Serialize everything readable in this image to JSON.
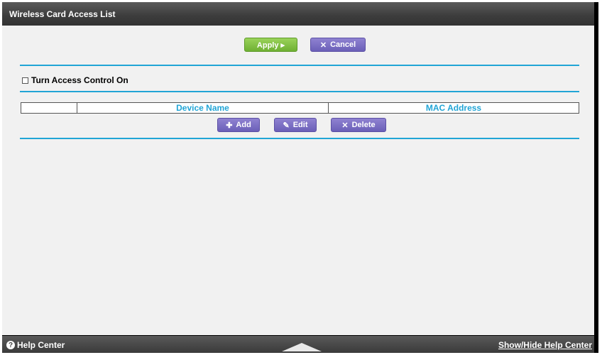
{
  "title": "Wireless Card Access List",
  "buttons": {
    "apply": "Apply ▸",
    "cancel": "Cancel",
    "add": "Add",
    "edit": "Edit",
    "delete": "Delete"
  },
  "icons": {
    "cancel": "close-icon",
    "add": "plus-icon",
    "edit": "pencil-icon",
    "delete": "close-icon",
    "help": "question-icon"
  },
  "access_control": {
    "label": "Turn Access Control On",
    "checked": false
  },
  "table": {
    "columns": [
      "",
      "Device Name",
      "MAC Address"
    ]
  },
  "footer": {
    "help_center": "Help Center",
    "toggle": "Show/Hide Help Center"
  },
  "colors": {
    "accent": "#21a5d6",
    "apply_green": "#7dbf3f",
    "button_purple": "#7b6fc4",
    "titlebar": "#3f3f3f"
  }
}
